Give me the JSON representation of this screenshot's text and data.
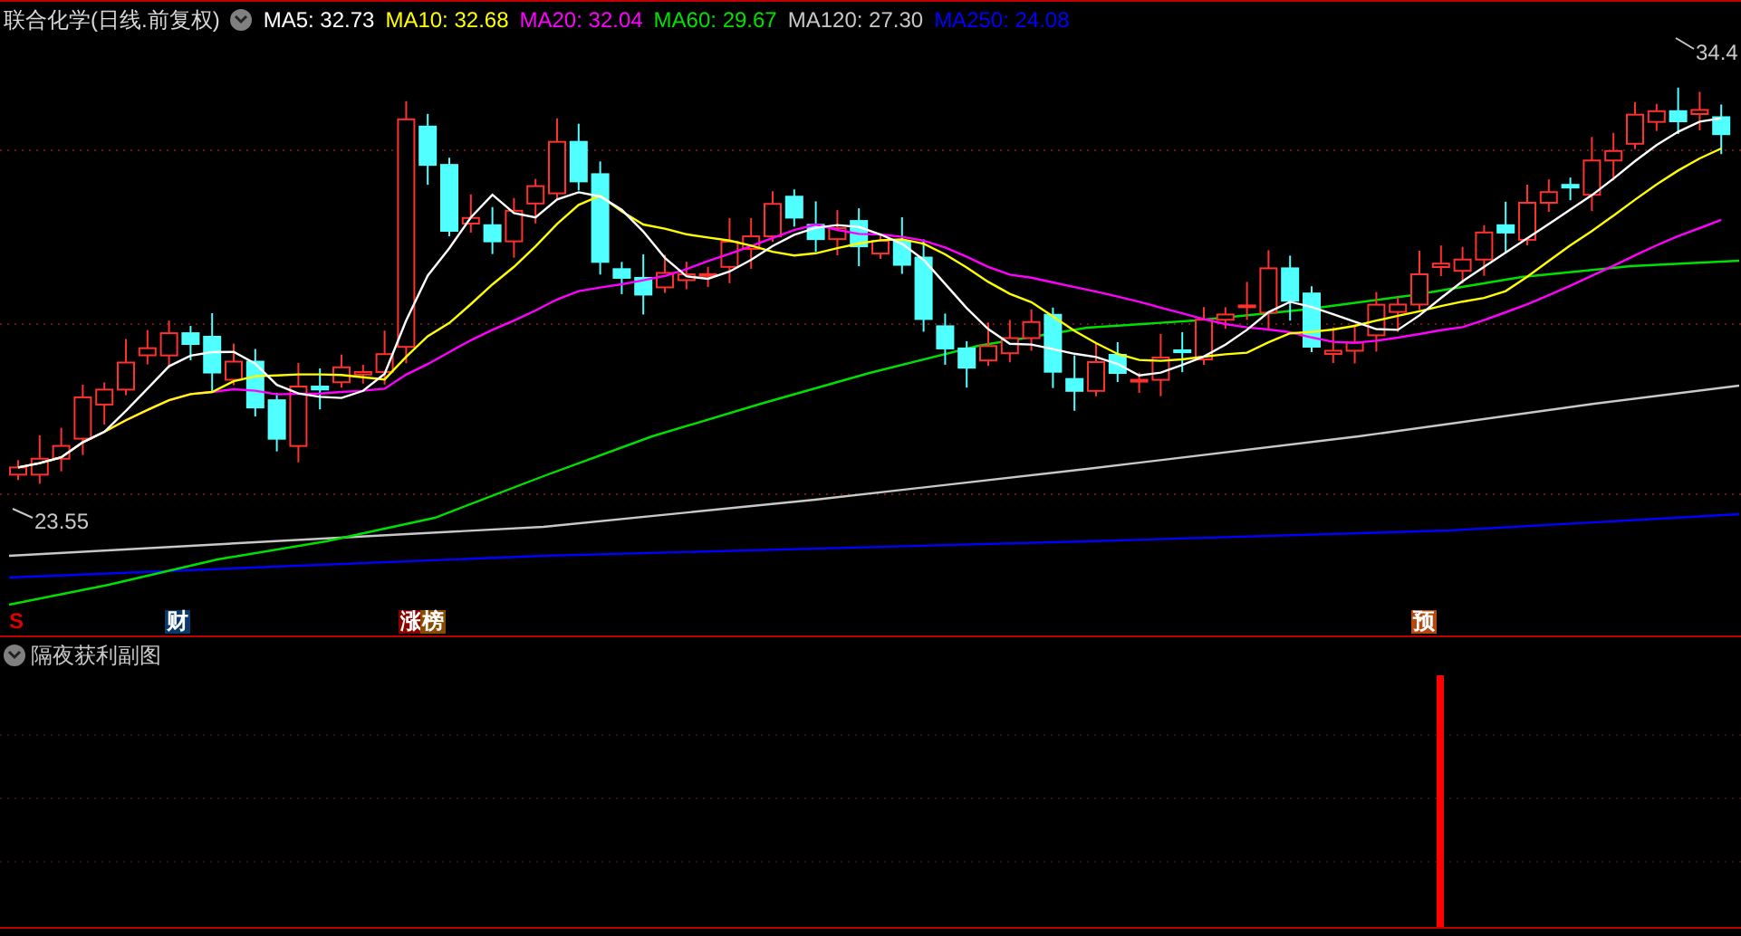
{
  "header": {
    "title": "联合化学(日线.前复权)",
    "legend": [
      {
        "label": "MA5: 32.73",
        "color": "#ffffff"
      },
      {
        "label": "MA10: 32.68",
        "color": "#ffff00"
      },
      {
        "label": "MA20: 32.04",
        "color": "#ff00ff"
      },
      {
        "label": "MA60: 29.67",
        "color": "#00e000"
      },
      {
        "label": "MA120: 27.30",
        "color": "#c8c8c8"
      },
      {
        "label": "MA250: 24.08",
        "color": "#0000ff"
      }
    ]
  },
  "main_chart": {
    "high_label": "34.4",
    "low_label": "23.55"
  },
  "markers": [
    {
      "text": "S",
      "color": "#e00000",
      "kind": "plain"
    },
    {
      "text": "财",
      "color": "#0a3a6a",
      "kind": "badge"
    },
    {
      "text": "涨",
      "color": "#8a0000",
      "kind": "badge"
    },
    {
      "text": "榜",
      "color": "#8a4a00",
      "kind": "badge"
    },
    {
      "text": "预",
      "color": "#b04a10",
      "kind": "badge"
    }
  ],
  "sub_panel": {
    "title": "隔夜获利副图"
  }
}
